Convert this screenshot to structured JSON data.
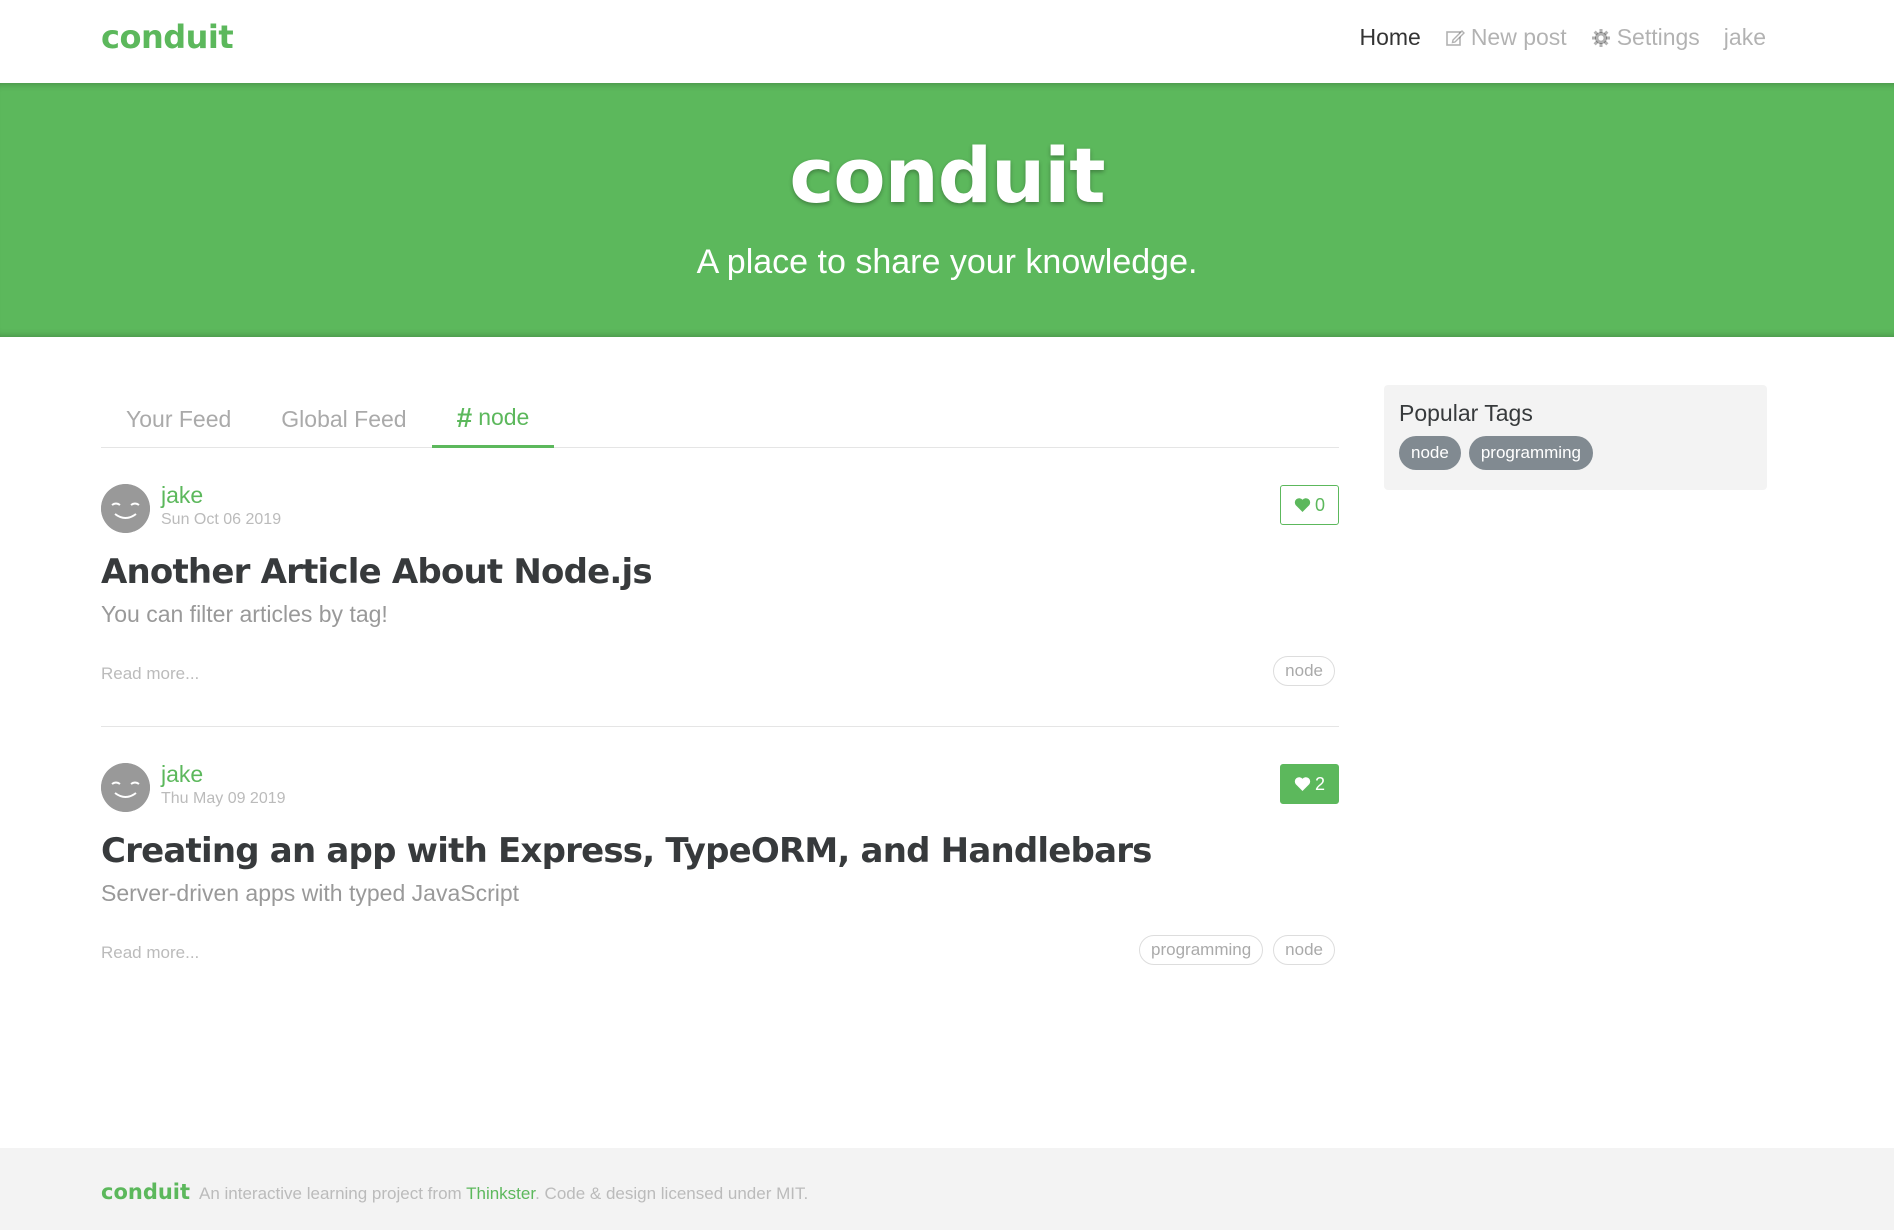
{
  "colors": {
    "brand": "#5cb85c",
    "tag_pill": "#818a91",
    "muted": "#bbbbbb"
  },
  "navbar": {
    "brand": "conduit",
    "links": [
      {
        "label": "Home",
        "active": true,
        "icon": null
      },
      {
        "label": "New post",
        "active": false,
        "icon": "edit-icon"
      },
      {
        "label": "Settings",
        "active": false,
        "icon": "gear-icon"
      },
      {
        "label": "jake",
        "active": false,
        "icon": null
      }
    ]
  },
  "banner": {
    "title": "conduit",
    "subtitle": "A place to share your knowledge."
  },
  "feed": {
    "tabs": [
      {
        "label": "Your Feed",
        "active": false
      },
      {
        "label": "Global Feed",
        "active": false
      },
      {
        "label": "node",
        "active": true,
        "prefix": "#"
      }
    ]
  },
  "articles": [
    {
      "author": "jake",
      "date": "Sun Oct 06 2019",
      "likes": "0",
      "liked": false,
      "title": "Another Article About Node.js",
      "description": "You can filter articles by tag!",
      "read_more": "Read more...",
      "tags": [
        "node"
      ]
    },
    {
      "author": "jake",
      "date": "Thu May 09 2019",
      "likes": "2",
      "liked": true,
      "title": "Creating an app with Express, TypeORM, and Handlebars",
      "description": "Server-driven apps with typed JavaScript",
      "read_more": "Read more...",
      "tags": [
        "programming",
        "node"
      ]
    }
  ],
  "sidebar": {
    "title": "Popular Tags",
    "tags": [
      "node",
      "programming"
    ]
  },
  "footer": {
    "brand": "conduit",
    "text_before": "An interactive learning project from ",
    "link": "Thinkster",
    "text_after": ". Code & design licensed under MIT."
  }
}
